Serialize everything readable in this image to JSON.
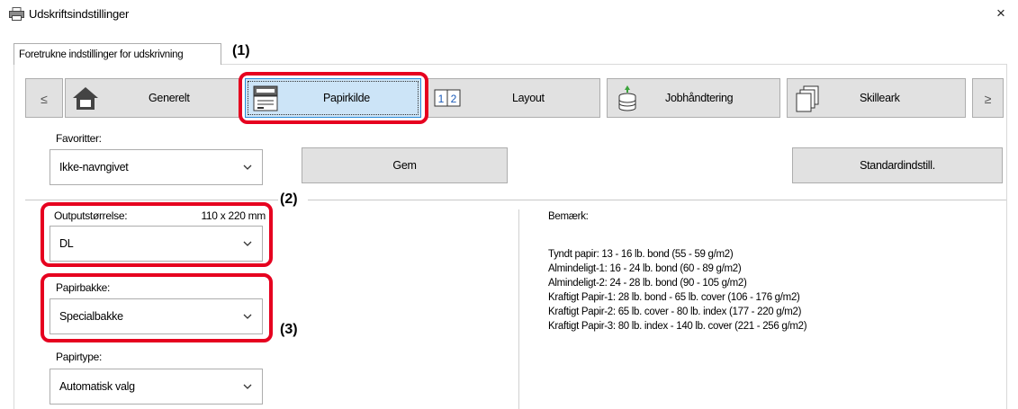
{
  "window": {
    "title": "Udskriftsindstillinger",
    "close_glyph": "×"
  },
  "tabs": [
    {
      "label": "Foretrukne indstillinger for udskrivning"
    }
  ],
  "callouts": {
    "c1": "(1)",
    "c2": "(2)",
    "c3": "(3)"
  },
  "toolbar": {
    "prev": "≤",
    "next": "≥",
    "items": [
      {
        "label": "Generelt",
        "icon": "home-icon"
      },
      {
        "label": "Papirkilde",
        "icon": "printer-tray-icon",
        "selected": true
      },
      {
        "label": "Layout",
        "icon": "page-layout-icon"
      },
      {
        "label": "Jobhåndtering",
        "icon": "job-stack-icon"
      },
      {
        "label": "Skilleark",
        "icon": "separator-pages-icon"
      }
    ]
  },
  "favorites": {
    "label": "Favoritter:",
    "value": "Ikke-navngivet",
    "save_label": "Gem",
    "defaults_label": "Standardindstill."
  },
  "output_size": {
    "label": "Outputstørrelse:",
    "dims": "110 x 220 mm",
    "value": "DL"
  },
  "paper_tray": {
    "label": "Papirbakke:",
    "value": "Specialbakke"
  },
  "paper_type": {
    "label": "Papirtype:",
    "value": "Automatisk valg"
  },
  "notes": {
    "heading": "Bemærk:",
    "lines": [
      "Tyndt papir: 13 - 16 lb. bond (55 - 59 g/m2)",
      "Almindeligt-1: 16 - 24 lb. bond (60 - 89 g/m2)",
      "Almindeligt-2: 24 - 28 lb. bond (90 - 105 g/m2)",
      "Kraftigt Papir-1: 28 lb. bond - 65 lb. cover (106 - 176 g/m2)",
      "Kraftigt Papir-2: 65 lb. cover - 80 lb. index (177 - 220 g/m2)",
      "Kraftigt Papir-3: 80 lb. index - 140 lb. cover (221 - 256 g/m2)"
    ]
  },
  "colors": {
    "highlight_red": "#e6001f",
    "selected_bg": "#cce4f7",
    "selected_border": "#2a8ad8",
    "button_bg": "#e1e1e1"
  }
}
